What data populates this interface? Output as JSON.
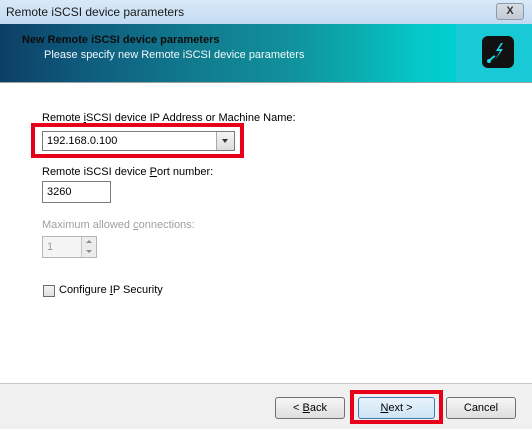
{
  "window": {
    "title": "Remote iSCSI device parameters",
    "close_label": "X"
  },
  "banner": {
    "title": "New Remote iSCSI device parameters",
    "subtitle": "Please specify new Remote iSCSI device parameters",
    "icon": "plug-lightning-icon"
  },
  "form": {
    "ip_label": {
      "before": "Remote ",
      "accel": "i",
      "after": "SCSI device IP Address or Machine Name:"
    },
    "ip_value": "192.168.0.100",
    "port_label": {
      "before": "Remote iSCSI device ",
      "accel": "P",
      "after": "ort number:"
    },
    "port_value": "3260",
    "connections_label": {
      "before": "Maximum allowed ",
      "accel": "c",
      "after": "onnections:"
    },
    "connections_value": "1",
    "ipsec_label": {
      "before": "Configure ",
      "accel": "I",
      "after": "P Security"
    },
    "ipsec_checked": false
  },
  "footer": {
    "back_label": {
      "before": "< ",
      "accel": "B",
      "after": "ack"
    },
    "next_label": {
      "before": "",
      "accel": "N",
      "after": "ext >"
    },
    "cancel_label": "Cancel"
  },
  "colors": {
    "highlight": "#e8001a",
    "banner_dark": "#0d3f66",
    "banner_light": "#00cfcf"
  }
}
